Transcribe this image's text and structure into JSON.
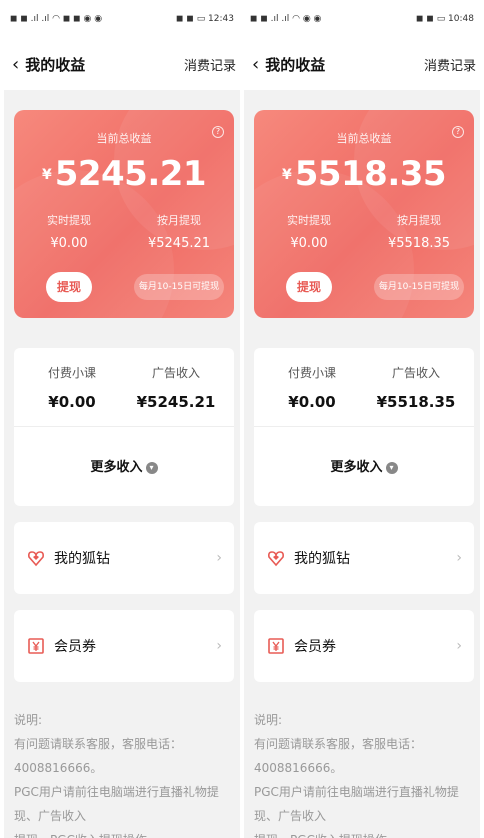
{
  "screens": [
    {
      "status": {
        "left": "◼ ◼ .ıl .ıl ◠ ◼ ◼ ◉ ◉",
        "right": "◼ ◼ ▭ 12:43"
      },
      "nav": {
        "title": "我的收益",
        "right_link": "消费记录"
      },
      "card": {
        "total_label": "当前总收益",
        "currency": "¥",
        "total": "5245.21",
        "realtime_label": "实时提现",
        "realtime_value": "¥0.00",
        "monthly_label": "按月提现",
        "monthly_value": "¥5245.21",
        "withdraw_button": "提现",
        "monthly_hint": "每月10-15日可提现"
      },
      "income": {
        "paid_label": "付费小课",
        "paid_value": "¥0.00",
        "ad_label": "广告收入",
        "ad_value": "¥5245.21",
        "more": "更多收入"
      },
      "rows": [
        {
          "label": "我的狐钻",
          "icon": "heart-diamond-icon"
        },
        {
          "label": "会员券",
          "icon": "yen-ticket-icon"
        }
      ],
      "notes": [
        "说明:",
        "有问题请联系客服，客服电话：4008816666。",
        "PGC用户请前往电脑端进行直播礼物提现、广告收入",
        "提现、PGC收入提现操作。"
      ]
    },
    {
      "status": {
        "left": "◼ ◼ .ıl .ıl ◠ ◉ ◉",
        "right": "◼ ◼ ▭ 10:48"
      },
      "nav": {
        "title": "我的收益",
        "right_link": "消费记录"
      },
      "card": {
        "total_label": "当前总收益",
        "currency": "¥",
        "total": "5518.35",
        "realtime_label": "实时提现",
        "realtime_value": "¥0.00",
        "monthly_label": "按月提现",
        "monthly_value": "¥5518.35",
        "withdraw_button": "提现",
        "monthly_hint": "每月10-15日可提现"
      },
      "income": {
        "paid_label": "付费小课",
        "paid_value": "¥0.00",
        "ad_label": "广告收入",
        "ad_value": "¥5518.35",
        "more": "更多收入"
      },
      "rows": [
        {
          "label": "我的狐钻",
          "icon": "heart-diamond-icon"
        },
        {
          "label": "会员券",
          "icon": "yen-ticket-icon"
        }
      ],
      "notes": [
        "说明:",
        "有问题请联系客服，客服电话：4008816666。",
        "PGC用户请前往电脑端进行直播礼物提现、广告收入",
        "提现、PGC收入提现操作。"
      ]
    }
  ],
  "colors": {
    "accent": "#f06a63",
    "page_bg": "#f2f2f2"
  }
}
